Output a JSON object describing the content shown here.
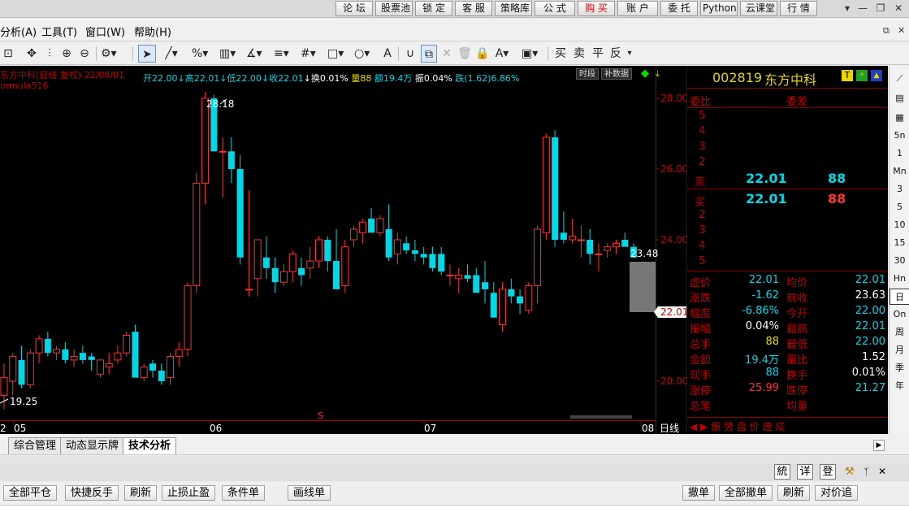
{
  "topbar": {
    "buttons": [
      "论 坛",
      "股票池",
      "锁 定",
      "客 服",
      "策略库",
      "公 式",
      "购 买",
      "账 户",
      "委 托",
      "Python",
      "云课堂",
      "行 情"
    ],
    "controls": [
      "▾",
      "—",
      "❐",
      "✕"
    ]
  },
  "menu": {
    "items": [
      "分析(A)",
      "工具(T)",
      "窗口(W)",
      "帮助(H)"
    ],
    "window_controls": [
      "⧉",
      "✕"
    ]
  },
  "toolbar": {
    "trade_labels": [
      "买",
      "卖",
      "平",
      "反"
    ]
  },
  "chart": {
    "title": "东方中科(日线 复权) 22/08/01",
    "open": "开22.00",
    "high": "↓高22.01",
    "low": "↓低22.00",
    "close": "↓收22.01",
    "turnover": "↓换0.01%",
    "volume": "量88",
    "amount": "额19.4万",
    "amplitude": "振0.04%",
    "change": "跌(1.62)6.86%",
    "formula": "ormula516",
    "btn_period": "时段",
    "btn_fill": "补数据",
    "max_label": "28.18",
    "min_label": "19.25",
    "last_label": "23.48",
    "current_price": "22.01",
    "price_axis": [
      "28.00",
      "26.00",
      "24.00",
      "20.00"
    ],
    "date_axis": [
      "2",
      "05",
      "06",
      "07",
      "08",
      "日线"
    ],
    "marker": "S",
    "colors": {
      "up": "#ff3232",
      "down": "#00d8e8",
      "bg": "#000000",
      "axis": "#a00000"
    }
  },
  "chart_data": {
    "type": "candlestick",
    "period": "日线",
    "y_ticks": [
      20,
      22,
      24,
      26,
      28
    ],
    "ylim": [
      18.5,
      29.0
    ],
    "candles": [
      {
        "o": 19.6,
        "h": 20.5,
        "l": 19.2,
        "c": 20.1
      },
      {
        "o": 20.0,
        "h": 20.8,
        "l": 19.6,
        "c": 20.7
      },
      {
        "o": 20.6,
        "h": 21.0,
        "l": 19.8,
        "c": 19.9
      },
      {
        "o": 19.9,
        "h": 20.9,
        "l": 19.8,
        "c": 20.8
      },
      {
        "o": 20.8,
        "h": 21.3,
        "l": 20.5,
        "c": 21.2
      },
      {
        "o": 21.2,
        "h": 21.4,
        "l": 20.7,
        "c": 20.8
      },
      {
        "o": 20.8,
        "h": 21.0,
        "l": 20.6,
        "c": 20.9
      },
      {
        "o": 20.9,
        "h": 21.1,
        "l": 20.5,
        "c": 20.6
      },
      {
        "o": 20.6,
        "h": 20.9,
        "l": 20.4,
        "c": 20.7
      },
      {
        "o": 20.8,
        "h": 21.0,
        "l": 20.5,
        "c": 20.6
      },
      {
        "o": 20.7,
        "h": 20.8,
        "l": 20.3,
        "c": 20.6
      },
      {
        "o": 20.2,
        "h": 20.5,
        "l": 20.1,
        "c": 20.6
      },
      {
        "o": 20.4,
        "h": 20.8,
        "l": 20.2,
        "c": 20.5
      },
      {
        "o": 20.6,
        "h": 21.0,
        "l": 20.5,
        "c": 20.8
      },
      {
        "o": 20.8,
        "h": 21.4,
        "l": 20.7,
        "c": 21.3
      },
      {
        "o": 21.4,
        "h": 21.6,
        "l": 20.8,
        "c": 20.1
      },
      {
        "o": 20.1,
        "h": 20.5,
        "l": 20.0,
        "c": 20.4
      },
      {
        "o": 20.5,
        "h": 20.6,
        "l": 20.1,
        "c": 20.3
      },
      {
        "o": 20.3,
        "h": 20.5,
        "l": 19.9,
        "c": 20.0
      },
      {
        "o": 20.1,
        "h": 20.8,
        "l": 19.9,
        "c": 20.7
      },
      {
        "o": 20.7,
        "h": 21.1,
        "l": 20.4,
        "c": 20.9
      },
      {
        "o": 20.9,
        "h": 22.8,
        "l": 20.7,
        "c": 22.7
      },
      {
        "o": 22.7,
        "h": 25.9,
        "l": 22.5,
        "c": 25.6
      },
      {
        "o": 25.6,
        "h": 28.18,
        "l": 25.0,
        "c": 28.0
      },
      {
        "o": 28.0,
        "h": 28.1,
        "l": 26.9,
        "c": 26.5
      },
      {
        "o": 26.5,
        "h": 26.9,
        "l": 25.2,
        "c": 26.5
      },
      {
        "o": 26.5,
        "h": 26.9,
        "l": 25.6,
        "c": 26.0
      },
      {
        "o": 26.0,
        "h": 26.4,
        "l": 23.3,
        "c": 23.5
      },
      {
        "o": 22.6,
        "h": 25.4,
        "l": 22.4,
        "c": 22.6
      },
      {
        "o": 22.9,
        "h": 23.9,
        "l": 22.4,
        "c": 24.0
      },
      {
        "o": 23.5,
        "h": 24.1,
        "l": 22.9,
        "c": 23.2
      },
      {
        "o": 23.2,
        "h": 23.5,
        "l": 22.5,
        "c": 22.8
      },
      {
        "o": 22.8,
        "h": 23.3,
        "l": 22.7,
        "c": 23.1
      },
      {
        "o": 23.1,
        "h": 23.7,
        "l": 22.8,
        "c": 23.6
      },
      {
        "o": 23.2,
        "h": 23.5,
        "l": 22.7,
        "c": 23.0
      },
      {
        "o": 23.2,
        "h": 23.8,
        "l": 22.9,
        "c": 23.4
      },
      {
        "o": 23.4,
        "h": 24.1,
        "l": 23.2,
        "c": 24.0
      },
      {
        "o": 24.0,
        "h": 24.1,
        "l": 23.1,
        "c": 23.4
      },
      {
        "o": 23.4,
        "h": 24.3,
        "l": 22.6,
        "c": 22.6
      },
      {
        "o": 22.7,
        "h": 24.0,
        "l": 22.5,
        "c": 23.8
      },
      {
        "o": 24.0,
        "h": 24.4,
        "l": 23.8,
        "c": 24.3
      },
      {
        "o": 24.2,
        "h": 24.6,
        "l": 23.9,
        "c": 24.5
      },
      {
        "o": 24.6,
        "h": 24.9,
        "l": 24.2,
        "c": 24.2
      },
      {
        "o": 24.2,
        "h": 24.7,
        "l": 24.1,
        "c": 24.6
      },
      {
        "o": 24.3,
        "h": 25.0,
        "l": 23.4,
        "c": 23.5
      },
      {
        "o": 23.6,
        "h": 24.2,
        "l": 23.3,
        "c": 24.0
      },
      {
        "o": 23.9,
        "h": 24.1,
        "l": 23.6,
        "c": 23.7
      },
      {
        "o": 23.7,
        "h": 24.0,
        "l": 23.4,
        "c": 23.6
      },
      {
        "o": 23.6,
        "h": 23.8,
        "l": 23.3,
        "c": 23.5
      },
      {
        "o": 23.6,
        "h": 23.8,
        "l": 23.1,
        "c": 23.2
      },
      {
        "o": 23.6,
        "h": 23.8,
        "l": 23.0,
        "c": 23.1
      },
      {
        "o": 23.0,
        "h": 23.3,
        "l": 22.7,
        "c": 23.0
      },
      {
        "o": 22.9,
        "h": 23.2,
        "l": 22.5,
        "c": 23.0
      },
      {
        "o": 23.0,
        "h": 23.3,
        "l": 22.8,
        "c": 22.9
      },
      {
        "o": 23.0,
        "h": 23.2,
        "l": 22.6,
        "c": 22.5
      },
      {
        "o": 22.8,
        "h": 23.4,
        "l": 22.2,
        "c": 22.6
      },
      {
        "o": 22.5,
        "h": 22.8,
        "l": 21.8,
        "c": 21.8
      },
      {
        "o": 21.6,
        "h": 22.8,
        "l": 21.4,
        "c": 22.6
      },
      {
        "o": 22.6,
        "h": 22.9,
        "l": 22.2,
        "c": 22.4
      },
      {
        "o": 22.4,
        "h": 22.6,
        "l": 21.9,
        "c": 22.2
      },
      {
        "o": 22.0,
        "h": 22.8,
        "l": 21.9,
        "c": 22.7
      },
      {
        "o": 22.7,
        "h": 24.4,
        "l": 22.2,
        "c": 24.3
      },
      {
        "o": 24.2,
        "h": 27.0,
        "l": 24.0,
        "c": 26.9
      },
      {
        "o": 26.9,
        "h": 27.1,
        "l": 23.8,
        "c": 24.0
      },
      {
        "o": 24.2,
        "h": 24.8,
        "l": 23.9,
        "c": 24.0
      },
      {
        "o": 24.0,
        "h": 24.6,
        "l": 23.9,
        "c": 24.1
      },
      {
        "o": 24.0,
        "h": 24.4,
        "l": 23.5,
        "c": 24.0
      },
      {
        "o": 24.0,
        "h": 24.3,
        "l": 23.3,
        "c": 23.6
      },
      {
        "o": 23.6,
        "h": 23.9,
        "l": 23.1,
        "c": 23.6
      },
      {
        "o": 23.7,
        "h": 23.9,
        "l": 23.5,
        "c": 23.8
      },
      {
        "o": 23.8,
        "h": 24.0,
        "l": 23.6,
        "c": 23.9
      },
      {
        "o": 24.0,
        "h": 24.2,
        "l": 23.8,
        "c": 23.8
      },
      {
        "o": 23.8,
        "h": 23.9,
        "l": 23.48,
        "c": 23.5
      }
    ]
  },
  "quote": {
    "code": "002819",
    "name": "东方中科",
    "icons": [
      "T",
      "⚡",
      "▲"
    ],
    "header_left": "委比",
    "header_right": "委差",
    "sell_levels": [
      "5",
      "4",
      "3",
      "2"
    ],
    "sell1_label": "卖",
    "sell1_price": "22.01",
    "sell1_vol": "88",
    "buy1_label": "买",
    "buy1_price": "22.01",
    "buy1_vol": "88",
    "buy_levels": [
      "2",
      "3",
      "4",
      "5"
    ],
    "stats": [
      {
        "l1": "虚价",
        "v1": "22.01",
        "l2": "均价",
        "v2": "22.01",
        "c1": "#00d8e8",
        "c2": "#00d8e8"
      },
      {
        "l1": "涨跌",
        "v1": "-1.62",
        "l2": "前收",
        "v2": "23.63",
        "c1": "#00d8e8",
        "c2": "#ffffff"
      },
      {
        "l1": "幅度",
        "v1": "-6.86%",
        "l2": "今开",
        "v2": "22.00",
        "c1": "#00d8e8",
        "c2": "#00d8e8"
      },
      {
        "l1": "振幅",
        "v1": "0.04%",
        "l2": "最高",
        "v2": "22.01",
        "c1": "#ffffff",
        "c2": "#00d8e8"
      },
      {
        "l1": "总手",
        "v1": "88",
        "l2": "最低",
        "v2": "22.00",
        "c1": "#e8d800",
        "c2": "#00d8e8"
      },
      {
        "l1": "金额",
        "v1": "19.4万",
        "l2": "量比",
        "v2": "1.52",
        "c1": "#00d8e8",
        "c2": "#ffffff"
      },
      {
        "l1": "现手",
        "v1": "88",
        "l2": "换手",
        "v2": "0.01%",
        "c1": "#00d8e8",
        "c2": "#ffffff"
      },
      {
        "l1": "涨停",
        "v1": "25.99",
        "l2": "跌停",
        "v2": "21.27",
        "c1": "#ff3232",
        "c2": "#00d8e8"
      },
      {
        "l1": "总笔",
        "v1": "",
        "l2": "均量",
        "v2": "",
        "c1": "#ffffff",
        "c2": "#ffffff"
      }
    ],
    "bottom_tabs": "◀ ▶ 细 势 盘 价 連 成"
  },
  "right_strip": [
    "5n",
    "1",
    "Mn",
    "3",
    "5",
    "10",
    "15",
    "30",
    "Hn",
    "日",
    "On",
    "周",
    "月",
    "季",
    "年"
  ],
  "tabs": [
    "综合管理",
    "动态显示牌",
    "技术分析"
  ],
  "trade": {
    "icons": [
      "統",
      "详",
      "登"
    ],
    "left_buttons": [
      "全部平仓",
      "快捷反手",
      "刷新",
      "止损止盈",
      "条件单",
      "画线单"
    ],
    "right_buttons": [
      "撤单",
      "全部撤单",
      "刷新",
      "对价追"
    ]
  }
}
